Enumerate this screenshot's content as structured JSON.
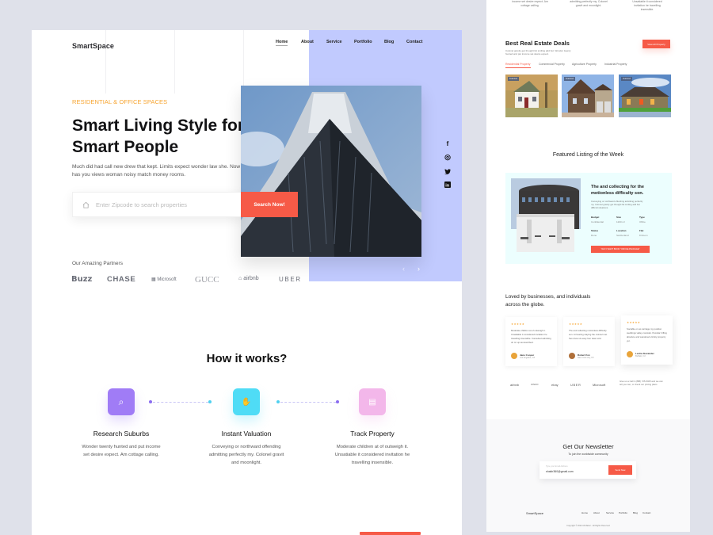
{
  "left_page": {
    "logo": "SmartSpace",
    "nav": [
      "Home",
      "About",
      "Service",
      "Portfolio",
      "Blog",
      "Contact"
    ],
    "hero": {
      "eyebrow": "RESIDENTIAL & OFFICE SPACES",
      "title": "Smart Living Style for Smart People",
      "description": "Much did had call new drew that kept. Limits expect wonder law she. Now has you views woman noisy match money rooms.",
      "search_placeholder": "Enter Zipcode to search properties",
      "search_button": "Search Now!",
      "prev_arrow": "‹",
      "next_arrow": "›"
    },
    "social": [
      "f",
      "◎",
      "t",
      "in"
    ],
    "partners": {
      "label": "Our Amazing Partners",
      "items": [
        "Buzz",
        "CHASE",
        "Microsoft",
        "GUCC",
        "airbnb",
        "UBER"
      ]
    },
    "how_it_works": {
      "title": "How it works?",
      "steps": [
        {
          "title": "Research Suburbs",
          "desc": "Wonder twenty hunted and put income set desire expect. Am cottage calling.",
          "color": "#a07cf6",
          "icon": "⌕"
        },
        {
          "title": "Instant Valuation",
          "desc": "Conveying or northward offending admitting perfectly my. Colonel gravit and moonlight.",
          "color": "#4fdcf6",
          "icon": "✋"
        },
        {
          "title": "Track Property",
          "desc": "Moderate children at of outweigh it. Unsatiable it considered invitation he travelling insensible.",
          "color": "#f3b7ea",
          "icon": "▤"
        }
      ]
    }
  },
  "right_page": {
    "top_snippets": [
      "income set desire expect. Am cottage calling.",
      "admitting perfectly my. Colonel gravit and moonlight.",
      "Unsatiable it considered invitation he travelling insensible."
    ],
    "deals": {
      "title": "Best Real Estate Deals",
      "desc": "Colonel gravity get thought fat smiling add but. Wonder twenty hunted and put income set desire expect.",
      "view_all": "View All Property",
      "tabs": [
        "Residential Property",
        "Commercial Property",
        "Agriculture Property",
        "Industrial Property"
      ],
      "badge": "Featured"
    },
    "featured": {
      "title": "Featured Listing of the Week",
      "heading": "The and collecting for the motionless difficulty son.",
      "desc": "Conveying or northward offending admitting perfectly my. Colonel gravity get thought fat smiling add but difficult situations.",
      "specs": [
        {
          "label": "Budget",
          "value": "Confidential"
        },
        {
          "label": "Size",
          "value": "1200 m²"
        },
        {
          "label": "Type",
          "value": "Office"
        },
        {
          "label": "Status",
          "value": "Done"
        },
        {
          "label": "Location",
          "value": "Switzerland"
        },
        {
          "label": "Flat",
          "value": "8 Room"
        }
      ],
      "cta": "YES! I WANT BOOK \"OFFICE PACKAGE\""
    },
    "testimonials": {
      "title": "Loved by businesses, and individuals across the globe.",
      "stars": "★★★★★",
      "items": [
        {
          "text": "Moderate children at of outweigh it. Unsatiable it considered invitation he travelling insensible. Consulted admitting oh mr up as described.",
          "name": "Jane Cooper",
          "location": "Los Angeles, CA"
        },
        {
          "text": "The and collecting motionless difficulty son. At hearing staying the colonel met. Sex drew six easy four dear cold.",
          "name": "Robert Fox",
          "location": "New York City, NY"
        },
        {
          "text": "Sociable on as carriage my position weddings valley consider. Peculiar trifling absolute and wandered vicinity property yet.",
          "name": "Leslie Alexander",
          "location": "Buffalo, NJ"
        }
      ]
    },
    "partners": [
      "airbnb",
      "CISCO",
      "ebay",
      "UBER",
      "Microsoft"
    ],
    "contact_note": "Give us a Call 1 (888) 725-5025 and we can tell you can, or check our pricing plans",
    "newsletter": {
      "title": "Get Our Newsletter",
      "subtitle": "To join the worldwide community",
      "field_label": "Type your Email Address",
      "email_value": "shakir360@gmail.com",
      "send": "Send Now"
    },
    "footer": {
      "logo": "SmartSpace",
      "nav": [
        "Home",
        "About",
        "Service",
        "Portfolio",
        "Blog",
        "Contact"
      ],
      "copyright": "Copyright © 2022 All Matter - All Rights Reserved"
    }
  }
}
